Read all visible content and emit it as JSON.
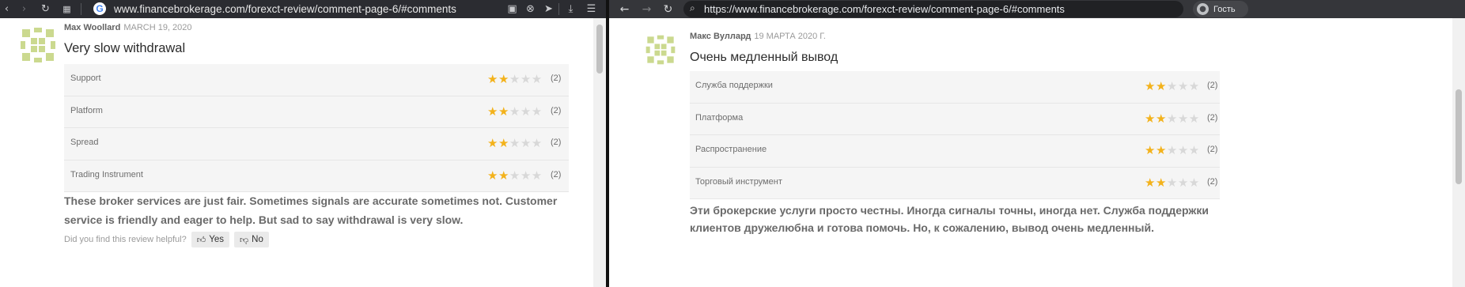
{
  "left_window": {
    "url": "www.financebrokerage.com/forexct-review/comment-page-6/#comments",
    "icons": [
      "back-icon",
      "forward-icon",
      "reload-icon",
      "grid-icon",
      "google-icon",
      "camera-icon",
      "shield-block-icon",
      "send-icon",
      "download-icon",
      "menu-icon"
    ],
    "review": {
      "author": "Max Woollard",
      "date": "MARCH 19, 2020",
      "title": "Very slow withdrawal",
      "ratings": [
        {
          "label": "Support",
          "stars": 2,
          "max": 5,
          "count": "(2)"
        },
        {
          "label": "Platform",
          "stars": 2,
          "max": 5,
          "count": "(2)"
        },
        {
          "label": "Spread",
          "stars": 2,
          "max": 5,
          "count": "(2)"
        },
        {
          "label": "Trading Instrument",
          "stars": 2,
          "max": 5,
          "count": "(2)"
        }
      ],
      "body": "These broker services are just fair. Sometimes signals are accurate sometimes not. Customer service is friendly and eager to help. But sad to say withdrawal is very slow.",
      "helpful_prompt": "Did you find this review helpful?",
      "yes_label": "Yes",
      "no_label": "No"
    }
  },
  "right_window": {
    "url": "https://www.financebrokerage.com/forexct-review/comment-page-6/#comments",
    "profile_label": "Гость",
    "icons": [
      "back-icon",
      "forward-icon",
      "reload-icon",
      "search-icon",
      "profile-icon"
    ],
    "review": {
      "author": "Макс Вуллард",
      "date": "19 МАРТА 2020 Г.",
      "title": "Очень медленный вывод",
      "ratings": [
        {
          "label": "Служба поддержки",
          "stars": 2,
          "max": 5,
          "count": "(2)"
        },
        {
          "label": "Платформа",
          "stars": 2,
          "max": 5,
          "count": "(2)"
        },
        {
          "label": "Распространение",
          "stars": 2,
          "max": 5,
          "count": "(2)"
        },
        {
          "label": "Торговый инструмент",
          "stars": 2,
          "max": 5,
          "count": "(2)"
        }
      ],
      "body": "Эти брокерские услуги просто честны. Иногда сигналы точны, иногда нет. Служба поддержки клиентов дружелюбна и готова помочь. Но, к сожалению, вывод очень медленный."
    }
  },
  "colors": {
    "star_filled": "#f3b21b",
    "star_empty": "#d8d8d8",
    "avatar_green": "#cbd98f",
    "left_toolbar_bg": "#2b2c31",
    "right_toolbar_bg": "#35363a"
  }
}
